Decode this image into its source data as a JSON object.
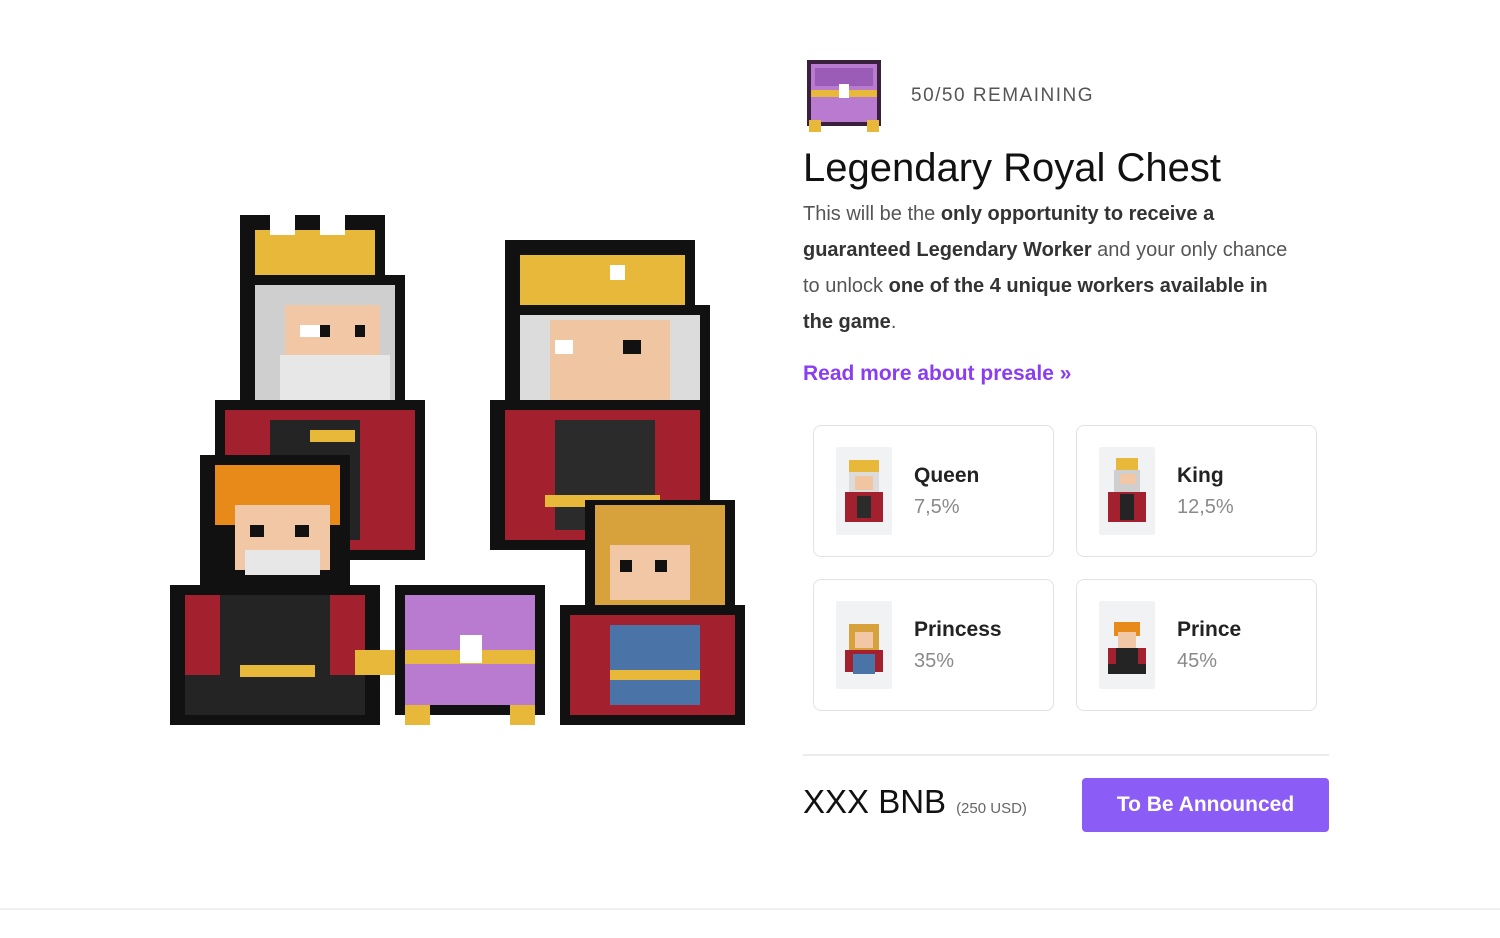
{
  "presale": {
    "remaining_text": "50/50 REMAINING",
    "title": "Legendary Royal Chest",
    "description": {
      "p1": "This will be the ",
      "b1": "only opportunity to receive a guaranteed Legendary Worker",
      "p2": " and your only chance to unlock ",
      "b2": "one of the 4 unique workers available in the game",
      "p3": "."
    },
    "read_more": "Read more about presale »"
  },
  "workers": [
    {
      "name": "Queen",
      "chance": "7,5%",
      "icon": "queen-sprite"
    },
    {
      "name": "King",
      "chance": "12,5%",
      "icon": "king-sprite"
    },
    {
      "name": "Princess",
      "chance": "35%",
      "icon": "princess-sprite"
    },
    {
      "name": "Prince",
      "chance": "45%",
      "icon": "prince-sprite"
    }
  ],
  "pricing": {
    "price": "XXX BNB",
    "usd": "(250 USD)",
    "button_label": "To Be Announced"
  },
  "colors": {
    "accent": "#8b5cf6",
    "link": "#8b3df0",
    "chest_purple": "#b97bd0",
    "crown_gold": "#e8b83a",
    "robe_red": "#a3202f"
  }
}
